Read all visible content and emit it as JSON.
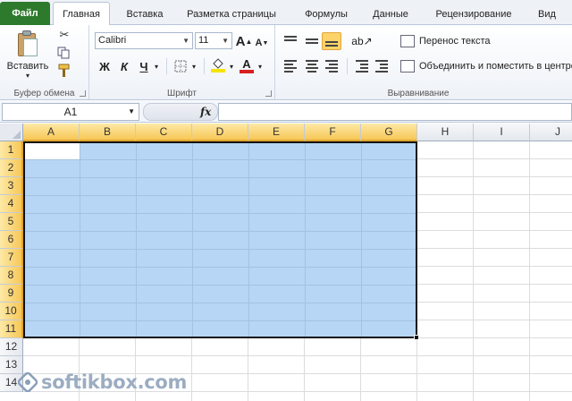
{
  "tabs": {
    "file": "Файл",
    "items": [
      "Главная",
      "Вставка",
      "Разметка страницы",
      "Формулы",
      "Данные",
      "Рецензирование",
      "Вид"
    ],
    "active": "Главная"
  },
  "ribbon": {
    "clipboard": {
      "paste_label": "Вставить",
      "group_label": "Буфер обмена",
      "icons": [
        "scissors-icon",
        "copy-icon",
        "format-painter-icon"
      ]
    },
    "font": {
      "family": "Calibri",
      "size": "11",
      "grow_label": "A",
      "shrink_label": "A",
      "bold_label": "Ж",
      "italic_label": "К",
      "underline_label": "Ч",
      "font_color_label": "A",
      "group_label": "Шрифт",
      "highlight_color": "#f5e400",
      "font_color": "#d82020"
    },
    "alignment": {
      "wrap_text_label": "Перенос текста",
      "merge_label": "Объединить и поместить в центре",
      "group_label": "Выравнивание",
      "selected_button": "middle-align"
    }
  },
  "formula_bar": {
    "name_box": "A1",
    "fx_label": "fx",
    "formula": ""
  },
  "sheet": {
    "columns": [
      "A",
      "B",
      "C",
      "D",
      "E",
      "F",
      "G",
      "H",
      "I",
      "J"
    ],
    "rows": [
      "1",
      "2",
      "3",
      "4",
      "5",
      "6",
      "7",
      "8",
      "9",
      "10",
      "11",
      "12",
      "13",
      "14"
    ],
    "selection": "A1:G11",
    "active_cell": "A1",
    "selection_color": "#b7d6f5",
    "header_highlight_color": "#f7c757"
  },
  "watermark": {
    "text": "softikbox.com",
    "color": "#8b9fb8"
  }
}
